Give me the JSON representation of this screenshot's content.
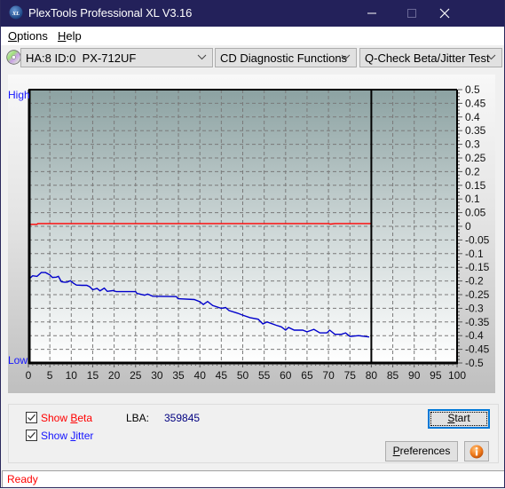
{
  "window": {
    "title": "PlexTools Professional XL V3.16",
    "icon": "xl-logo-icon",
    "controls": {
      "minimize": "minimize-icon",
      "maximize": "maximize-icon",
      "close": "close-icon"
    }
  },
  "menu": {
    "items": [
      {
        "pre": "",
        "acc": "O",
        "post": "ptions"
      },
      {
        "pre": "",
        "acc": "H",
        "post": "elp"
      }
    ]
  },
  "toolbar": {
    "drive_icon": "cd-drive-icon",
    "drive": "HA:8 ID:0  PX-712UF",
    "function": "CD Diagnostic Functions",
    "test": "Q-Check Beta/Jitter Test"
  },
  "chart_data": {
    "type": "line",
    "title": "",
    "xlabel": "",
    "ylabel": "",
    "xlim": [
      0,
      100
    ],
    "ylim": [
      -0.5,
      0.5
    ],
    "grid": true,
    "left_labels": {
      "high": "High",
      "low": "Low"
    },
    "x_ticks": [
      0,
      5,
      10,
      15,
      20,
      25,
      30,
      35,
      40,
      45,
      50,
      55,
      60,
      65,
      70,
      75,
      80,
      85,
      90,
      95,
      100
    ],
    "y_ticks": [
      0.5,
      0.45,
      0.4,
      0.35,
      0.3,
      0.25,
      0.2,
      0.15,
      0.1,
      0.05,
      0,
      -0.05,
      -0.1,
      -0.15,
      -0.2,
      -0.25,
      -0.3,
      -0.35,
      -0.4,
      -0.45,
      -0.5
    ],
    "y_tick_labels": [
      "0.5",
      "0.45",
      "0.4",
      "0.35",
      "0.3",
      "0.25",
      "0.2",
      "0.15",
      "0.1",
      "0.05",
      "0",
      "-0.05",
      "-0.1",
      "-0.15",
      "-0.2",
      "-0.25",
      "-0.3",
      "-0.35",
      "-0.4",
      "-0.45",
      "-0.5"
    ],
    "y_axis_side": "right",
    "tested_range_end": 80,
    "series": [
      {
        "name": "Beta",
        "color": "#ff0000",
        "points": [
          [
            0,
            0.007
          ],
          [
            2,
            0.007
          ],
          [
            2.2,
            0.01
          ],
          [
            10,
            0.01
          ],
          [
            70,
            0.01
          ],
          [
            70.5,
            0.008
          ],
          [
            71.5,
            0.01
          ],
          [
            80,
            0.01
          ]
        ]
      },
      {
        "name": "Jitter",
        "color": "#0000cc",
        "points": [
          [
            0,
            -0.19
          ],
          [
            0.5,
            -0.188
          ],
          [
            1,
            -0.181
          ],
          [
            2,
            -0.183
          ],
          [
            2.8,
            -0.172
          ],
          [
            3,
            -0.169
          ],
          [
            4,
            -0.169
          ],
          [
            5,
            -0.178
          ],
          [
            5.6,
            -0.187
          ],
          [
            6.5,
            -0.186
          ],
          [
            7,
            -0.183
          ],
          [
            7.7,
            -0.203
          ],
          [
            8.5,
            -0.205
          ],
          [
            9.1,
            -0.204
          ],
          [
            9.8,
            -0.199
          ],
          [
            10.5,
            -0.208
          ],
          [
            11.2,
            -0.215
          ],
          [
            12.5,
            -0.216
          ],
          [
            13.6,
            -0.216
          ],
          [
            14.3,
            -0.221
          ],
          [
            15,
            -0.232
          ],
          [
            16,
            -0.227
          ],
          [
            16.7,
            -0.236
          ],
          [
            17.7,
            -0.226
          ],
          [
            18.4,
            -0.238
          ],
          [
            19.8,
            -0.235
          ],
          [
            20.5,
            -0.239
          ],
          [
            25,
            -0.239
          ],
          [
            25.3,
            -0.245
          ],
          [
            27.1,
            -0.252
          ],
          [
            27.8,
            -0.248
          ],
          [
            29,
            -0.256
          ],
          [
            34.5,
            -0.257
          ],
          [
            34.9,
            -0.265
          ],
          [
            38.7,
            -0.268
          ],
          [
            40,
            -0.276
          ],
          [
            40.8,
            -0.286
          ],
          [
            41.8,
            -0.275
          ],
          [
            43,
            -0.29
          ],
          [
            45,
            -0.3
          ],
          [
            46,
            -0.297
          ],
          [
            46.8,
            -0.308
          ],
          [
            48.8,
            -0.318
          ],
          [
            50,
            -0.325
          ],
          [
            51.7,
            -0.334
          ],
          [
            53.6,
            -0.34
          ],
          [
            54.7,
            -0.357
          ],
          [
            55.7,
            -0.35
          ],
          [
            57.8,
            -0.362
          ],
          [
            59,
            -0.368
          ],
          [
            60,
            -0.38
          ],
          [
            60.7,
            -0.37
          ],
          [
            62,
            -0.38
          ],
          [
            64,
            -0.38
          ],
          [
            65,
            -0.386
          ],
          [
            66.6,
            -0.377
          ],
          [
            68,
            -0.39
          ],
          [
            69.6,
            -0.39
          ],
          [
            70.3,
            -0.38
          ],
          [
            71.5,
            -0.395
          ],
          [
            73,
            -0.395
          ],
          [
            74,
            -0.39
          ],
          [
            75,
            -0.403
          ],
          [
            77,
            -0.4
          ],
          [
            79.5,
            -0.405
          ]
        ]
      }
    ]
  },
  "controls": {
    "show_beta": {
      "pre": "Show ",
      "acc": "B",
      "post": "eta",
      "checked": true
    },
    "show_jitter": {
      "pre": "Show ",
      "acc": "J",
      "post": "itter",
      "checked": true
    },
    "lba_label": "LBA:",
    "lba_value": "359845",
    "start": {
      "pre": "",
      "acc": "S",
      "post": "tart"
    },
    "preferences": {
      "pre": "",
      "acc": "P",
      "post": "references"
    },
    "info_icon": "info-icon"
  },
  "status": {
    "text": "Ready"
  },
  "colors": {
    "titlebar": "#23215a",
    "beta": "#ff0000",
    "jitter": "#0000cc",
    "high_low_label": "#1414ff",
    "lba_value": "#000080",
    "status_text": "#ff0000",
    "focus_border": "#0078d7"
  }
}
